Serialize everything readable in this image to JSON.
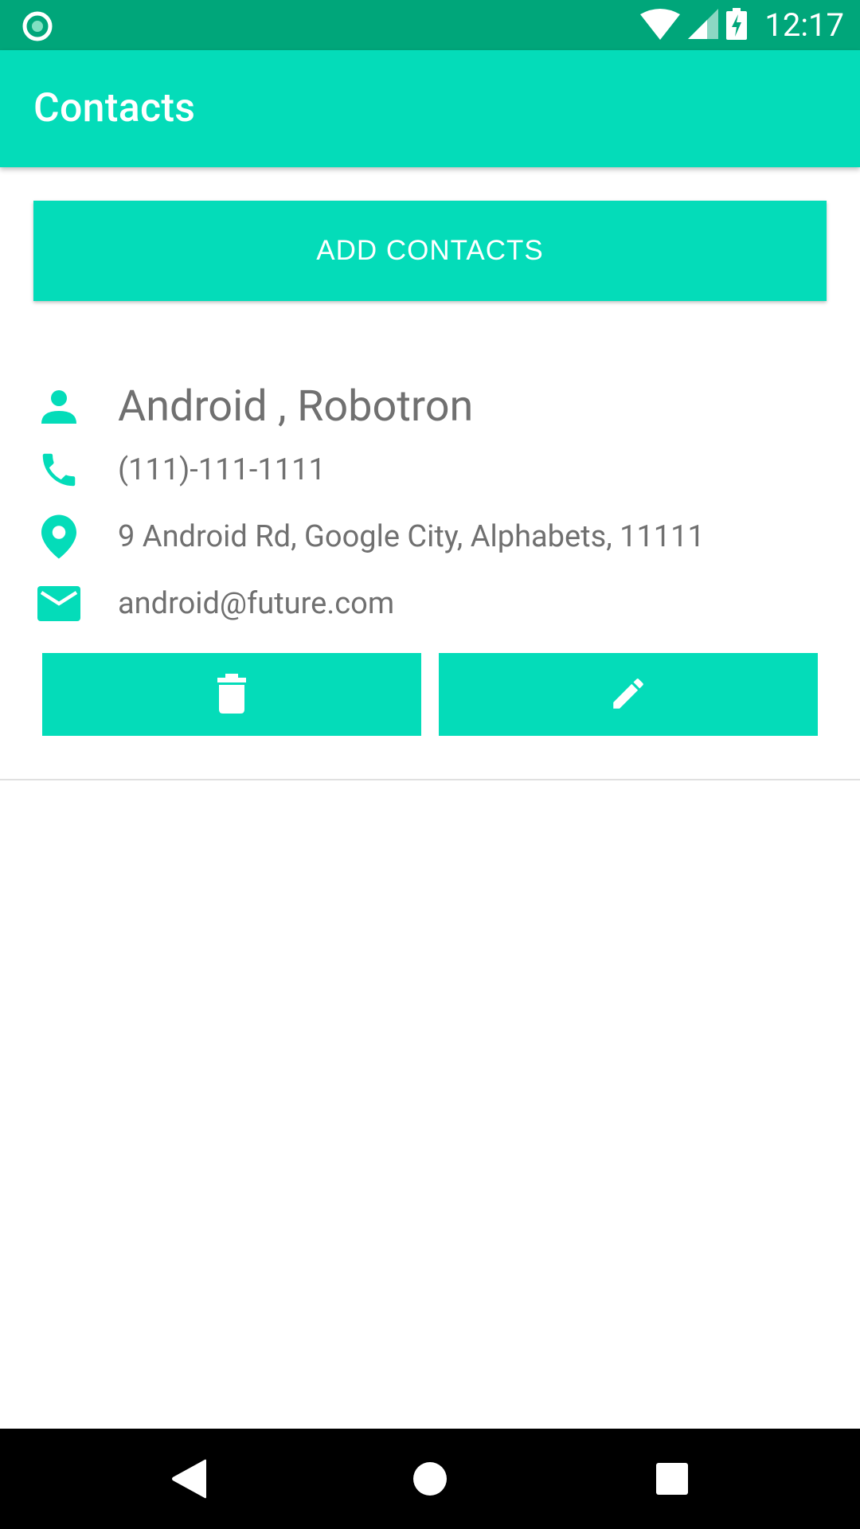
{
  "status_bar": {
    "time": "12:17",
    "icons": [
      "record-icon",
      "wifi-icon",
      "cell-signal-icon",
      "battery-charging-icon"
    ]
  },
  "app_bar": {
    "title": "Contacts"
  },
  "add_button": {
    "label": "ADD CONTACTS"
  },
  "contact": {
    "name": "Android , Robotron",
    "phone": "(111)-111-1111",
    "address": "9 Android Rd, Google City, Alphabets, 11111",
    "email": "android@future.com",
    "actions": [
      "delete-icon",
      "edit-icon"
    ]
  },
  "nav_bar": {
    "buttons": [
      "back-icon",
      "home-icon",
      "recents-icon"
    ]
  },
  "colors": {
    "accent": "#04dcb9",
    "status_bar": "#00a67a",
    "text": "#707070"
  }
}
